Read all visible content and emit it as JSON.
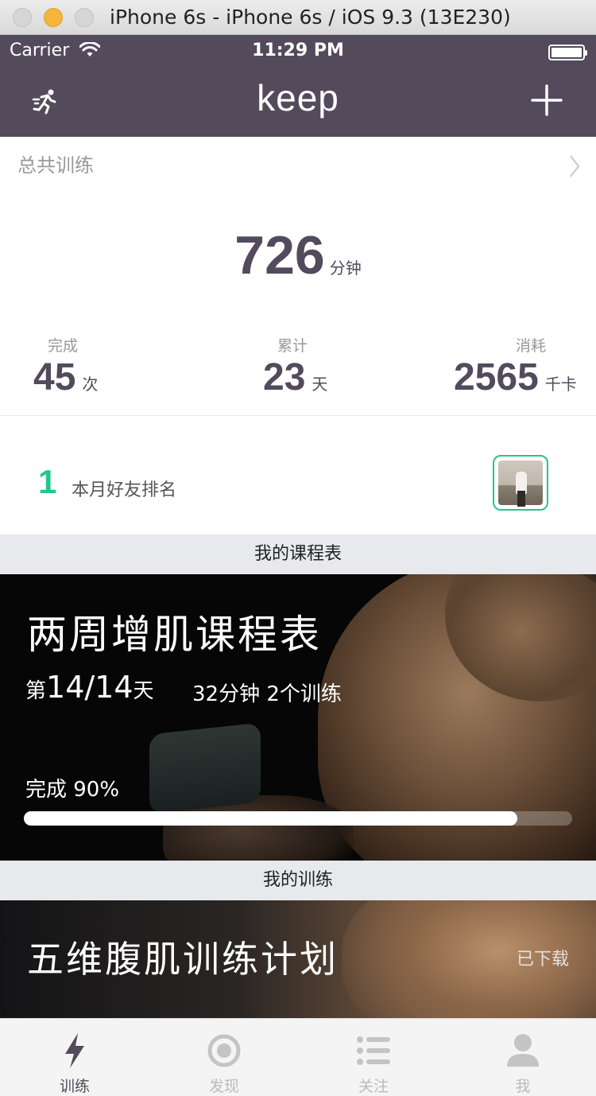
{
  "window": {
    "title": "iPhone 6s - iPhone 6s / iOS 9.3 (13E230)"
  },
  "status": {
    "carrier": "Carrier",
    "time": "11:29 PM"
  },
  "nav": {
    "logo": "keep"
  },
  "summary": {
    "label": "总共训练",
    "total_value": "726",
    "total_unit": "分钟",
    "stats": [
      {
        "label": "完成",
        "value": "45",
        "unit": "次"
      },
      {
        "label": "累计",
        "value": "23",
        "unit": "天"
      },
      {
        "label": "消耗",
        "value": "2565",
        "unit": "千卡"
      }
    ],
    "rank_value": "1",
    "rank_label": "本月好友排名"
  },
  "schedule": {
    "header": "我的课程表",
    "title": "两周增肌课程表",
    "day_prefix": "第",
    "day_value": "14/14",
    "day_suffix": "天",
    "meta": "32分钟 2个训练",
    "done_label": "完成 90%",
    "progress": 0.9
  },
  "training": {
    "header": "我的训练",
    "title": "五维腹肌训练计划",
    "status": "已下载"
  },
  "tabs": [
    {
      "label": "训练",
      "icon": "bolt-icon",
      "active": true
    },
    {
      "label": "发现",
      "icon": "target-icon",
      "active": false
    },
    {
      "label": "关注",
      "icon": "list-icon",
      "active": false
    },
    {
      "label": "我",
      "icon": "person-icon",
      "active": false
    }
  ],
  "colors": {
    "brand": "#534a5c",
    "accent": "#24c789"
  }
}
